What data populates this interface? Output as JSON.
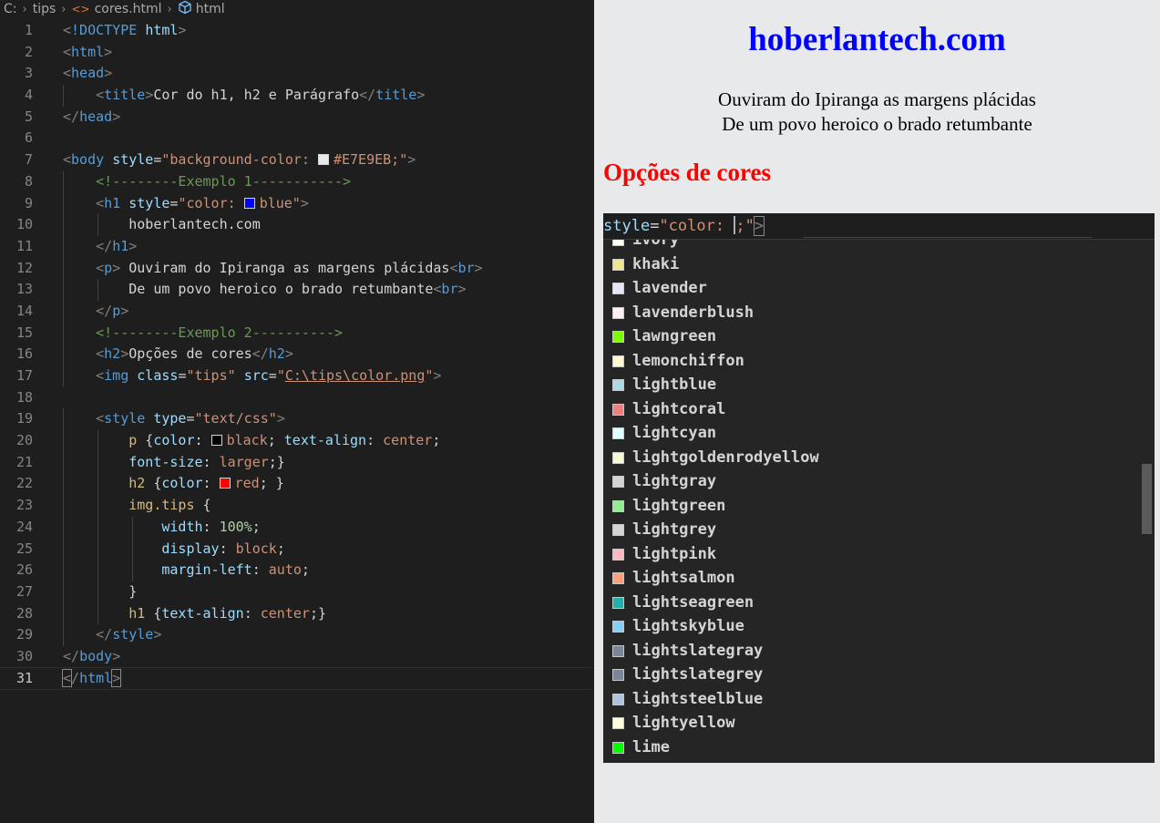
{
  "breadcrumb": {
    "drive": "C:",
    "folder": "tips",
    "file": "cores.html",
    "element": "html"
  },
  "editor": {
    "lines": [
      {
        "n": "1",
        "tokens": [
          {
            "t": "<",
            "c": "t-br"
          },
          {
            "t": "!DOCTYPE",
            "c": "t-tag"
          },
          {
            "t": " ",
            "c": "t-txt"
          },
          {
            "t": "html",
            "c": "t-attr"
          },
          {
            "t": ">",
            "c": "t-br"
          }
        ]
      },
      {
        "n": "2",
        "tokens": [
          {
            "t": "<",
            "c": "t-br"
          },
          {
            "t": "html",
            "c": "t-tag"
          },
          {
            "t": ">",
            "c": "t-br"
          }
        ]
      },
      {
        "n": "3",
        "tokens": [
          {
            "t": "<",
            "c": "t-br"
          },
          {
            "t": "head",
            "c": "t-tag"
          },
          {
            "t": ">",
            "c": "t-br"
          }
        ]
      },
      {
        "n": "4",
        "tokens": [
          {
            "t": "    "
          },
          {
            "t": "<",
            "c": "t-br"
          },
          {
            "t": "title",
            "c": "t-tag"
          },
          {
            "t": ">",
            "c": "t-br"
          },
          {
            "t": "Cor do h1, h2 e Parágrafo",
            "c": "t-txt"
          },
          {
            "t": "</",
            "c": "t-br"
          },
          {
            "t": "title",
            "c": "t-tag"
          },
          {
            "t": ">",
            "c": "t-br"
          }
        ]
      },
      {
        "n": "5",
        "tokens": [
          {
            "t": "</",
            "c": "t-br"
          },
          {
            "t": "head",
            "c": "t-tag"
          },
          {
            "t": ">",
            "c": "t-br"
          }
        ]
      },
      {
        "n": "6",
        "tokens": []
      },
      {
        "n": "7",
        "tokens": [
          {
            "t": "<",
            "c": "t-br"
          },
          {
            "t": "body",
            "c": "t-tag"
          },
          {
            "t": " ",
            "c": "t-txt"
          },
          {
            "t": "style",
            "c": "t-attr"
          },
          {
            "t": "=",
            "c": "t-txt"
          },
          {
            "t": "\"background-color: ",
            "c": "t-str"
          },
          {
            "sw": "#e7e9eb"
          },
          {
            "t": "#E7E9EB;\"",
            "c": "t-str"
          },
          {
            "t": ">",
            "c": "t-br"
          }
        ]
      },
      {
        "n": "8",
        "tokens": [
          {
            "t": "    "
          },
          {
            "t": "<!--------Exemplo 1----------->",
            "c": "t-cmt"
          }
        ]
      },
      {
        "n": "9",
        "tokens": [
          {
            "t": "    "
          },
          {
            "t": "<",
            "c": "t-br"
          },
          {
            "t": "h1",
            "c": "t-tag"
          },
          {
            "t": " ",
            "c": "t-txt"
          },
          {
            "t": "style",
            "c": "t-attr"
          },
          {
            "t": "=",
            "c": "t-txt"
          },
          {
            "t": "\"color: ",
            "c": "t-str"
          },
          {
            "sw": "#0000ff"
          },
          {
            "t": "blue\"",
            "c": "t-str"
          },
          {
            "t": ">",
            "c": "t-br"
          }
        ]
      },
      {
        "n": "10",
        "tokens": [
          {
            "t": "        "
          },
          {
            "t": "hoberlantech.com",
            "c": "t-txt"
          }
        ]
      },
      {
        "n": "11",
        "tokens": [
          {
            "t": "    "
          },
          {
            "t": "</",
            "c": "t-br"
          },
          {
            "t": "h1",
            "c": "t-tag"
          },
          {
            "t": ">",
            "c": "t-br"
          }
        ]
      },
      {
        "n": "12",
        "tokens": [
          {
            "t": "    "
          },
          {
            "t": "<",
            "c": "t-br"
          },
          {
            "t": "p",
            "c": "t-tag"
          },
          {
            "t": ">",
            "c": "t-br"
          },
          {
            "t": " Ouviram do Ipiranga as margens plácidas",
            "c": "t-txt"
          },
          {
            "t": "<",
            "c": "t-br"
          },
          {
            "t": "br",
            "c": "t-tag"
          },
          {
            "t": ">",
            "c": "t-br"
          }
        ]
      },
      {
        "n": "13",
        "tokens": [
          {
            "t": "        "
          },
          {
            "t": "De um povo heroico o brado retumbante",
            "c": "t-txt"
          },
          {
            "t": "<",
            "c": "t-br"
          },
          {
            "t": "br",
            "c": "t-tag"
          },
          {
            "t": ">",
            "c": "t-br"
          }
        ]
      },
      {
        "n": "14",
        "tokens": [
          {
            "t": "    "
          },
          {
            "t": "</",
            "c": "t-br"
          },
          {
            "t": "p",
            "c": "t-tag"
          },
          {
            "t": ">",
            "c": "t-br"
          }
        ]
      },
      {
        "n": "15",
        "tokens": [
          {
            "t": "    "
          },
          {
            "t": "<!--------Exemplo 2---------->",
            "c": "t-cmt"
          }
        ]
      },
      {
        "n": "16",
        "tokens": [
          {
            "t": "    "
          },
          {
            "t": "<",
            "c": "t-br"
          },
          {
            "t": "h2",
            "c": "t-tag"
          },
          {
            "t": ">",
            "c": "t-br"
          },
          {
            "t": "Opções de cores",
            "c": "t-txt"
          },
          {
            "t": "</",
            "c": "t-br"
          },
          {
            "t": "h2",
            "c": "t-tag"
          },
          {
            "t": ">",
            "c": "t-br"
          }
        ]
      },
      {
        "n": "17",
        "tokens": [
          {
            "t": "    "
          },
          {
            "t": "<",
            "c": "t-br"
          },
          {
            "t": "img",
            "c": "t-tag"
          },
          {
            "t": " ",
            "c": "t-txt"
          },
          {
            "t": "class",
            "c": "t-attr"
          },
          {
            "t": "=",
            "c": "t-txt"
          },
          {
            "t": "\"tips\"",
            "c": "t-str"
          },
          {
            "t": " ",
            "c": "t-txt"
          },
          {
            "t": "src",
            "c": "t-attr"
          },
          {
            "t": "=",
            "c": "t-txt"
          },
          {
            "t": "\"",
            "c": "t-str"
          },
          {
            "t": "C:\\tips\\color.png",
            "c": "t-link"
          },
          {
            "t": "\"",
            "c": "t-str"
          },
          {
            "t": ">",
            "c": "t-br"
          }
        ]
      },
      {
        "n": "18",
        "tokens": []
      },
      {
        "n": "19",
        "tokens": [
          {
            "t": "    "
          },
          {
            "t": "<",
            "c": "t-br"
          },
          {
            "t": "style",
            "c": "t-tag"
          },
          {
            "t": " ",
            "c": "t-txt"
          },
          {
            "t": "type",
            "c": "t-attr"
          },
          {
            "t": "=",
            "c": "t-txt"
          },
          {
            "t": "\"text/css\"",
            "c": "t-str"
          },
          {
            "t": ">",
            "c": "t-br"
          }
        ]
      },
      {
        "n": "20",
        "tokens": [
          {
            "t": "        "
          },
          {
            "t": "p",
            "c": "t-sel"
          },
          {
            "t": " {",
            "c": "t-txt"
          },
          {
            "t": "color",
            "c": "t-prop"
          },
          {
            "t": ": ",
            "c": "t-txt"
          },
          {
            "sw": "#000000"
          },
          {
            "t": "black",
            "c": "t-str"
          },
          {
            "t": "; ",
            "c": "t-txt"
          },
          {
            "t": "text-align",
            "c": "t-prop"
          },
          {
            "t": ": ",
            "c": "t-txt"
          },
          {
            "t": "center",
            "c": "t-str"
          },
          {
            "t": ";",
            "c": "t-txt"
          }
        ]
      },
      {
        "n": "21",
        "tokens": [
          {
            "t": "        "
          },
          {
            "t": "font-size",
            "c": "t-prop"
          },
          {
            "t": ": ",
            "c": "t-txt"
          },
          {
            "t": "larger",
            "c": "t-str"
          },
          {
            "t": ";}",
            "c": "t-txt"
          }
        ]
      },
      {
        "n": "22",
        "tokens": [
          {
            "t": "        "
          },
          {
            "t": "h2",
            "c": "t-sel"
          },
          {
            "t": " {",
            "c": "t-txt"
          },
          {
            "t": "color",
            "c": "t-prop"
          },
          {
            "t": ": ",
            "c": "t-txt"
          },
          {
            "sw": "#ff0000"
          },
          {
            "t": "red",
            "c": "t-str"
          },
          {
            "t": "; }",
            "c": "t-txt"
          }
        ]
      },
      {
        "n": "23",
        "tokens": [
          {
            "t": "        "
          },
          {
            "t": "img.tips",
            "c": "t-sel"
          },
          {
            "t": " {",
            "c": "t-txt"
          }
        ]
      },
      {
        "n": "24",
        "tokens": [
          {
            "t": "            "
          },
          {
            "t": "width",
            "c": "t-prop"
          },
          {
            "t": ": ",
            "c": "t-txt"
          },
          {
            "t": "100%",
            "c": "t-num"
          },
          {
            "t": ";",
            "c": "t-txt"
          }
        ]
      },
      {
        "n": "25",
        "tokens": [
          {
            "t": "            "
          },
          {
            "t": "display",
            "c": "t-prop"
          },
          {
            "t": ": ",
            "c": "t-txt"
          },
          {
            "t": "block",
            "c": "t-str"
          },
          {
            "t": ";",
            "c": "t-txt"
          }
        ]
      },
      {
        "n": "26",
        "tokens": [
          {
            "t": "            "
          },
          {
            "t": "margin-left",
            "c": "t-prop"
          },
          {
            "t": ": ",
            "c": "t-txt"
          },
          {
            "t": "auto",
            "c": "t-str"
          },
          {
            "t": ";",
            "c": "t-txt"
          }
        ]
      },
      {
        "n": "27",
        "tokens": [
          {
            "t": "        "
          },
          {
            "t": "}",
            "c": "t-txt"
          }
        ]
      },
      {
        "n": "28",
        "tokens": [
          {
            "t": "        "
          },
          {
            "t": "h1",
            "c": "t-sel"
          },
          {
            "t": " {",
            "c": "t-txt"
          },
          {
            "t": "text-align",
            "c": "t-prop"
          },
          {
            "t": ": ",
            "c": "t-txt"
          },
          {
            "t": "center",
            "c": "t-str"
          },
          {
            "t": ";}",
            "c": "t-txt"
          }
        ]
      },
      {
        "n": "29",
        "tokens": [
          {
            "t": "    "
          },
          {
            "t": "</",
            "c": "t-br"
          },
          {
            "t": "style",
            "c": "t-tag"
          },
          {
            "t": ">",
            "c": "t-br"
          }
        ]
      },
      {
        "n": "30",
        "tokens": [
          {
            "t": "</",
            "c": "t-br"
          },
          {
            "t": "body",
            "c": "t-tag"
          },
          {
            "t": ">",
            "c": "t-br"
          }
        ]
      },
      {
        "n": "31",
        "tokens": [
          {
            "t": "<",
            "c": "t-br caret-bracket"
          },
          {
            "t": "/",
            "c": "t-br"
          },
          {
            "t": "html",
            "c": "t-tag"
          },
          {
            "t": ">",
            "c": "t-br caret-bracket"
          }
        ]
      }
    ]
  },
  "preview": {
    "h1": "hoberlantech.com",
    "p_line1": "Ouviram do Ipiranga as margens plácidas",
    "p_line2": "De um povo heroico o brado retumbante",
    "h2": "Opções de cores"
  },
  "tips_image": {
    "code_attr": "style",
    "code_eq": "=",
    "code_str": "\"color: ",
    "code_end": ";\"",
    "code_close": ">",
    "suggestions": [
      {
        "name": "ivory",
        "color": "#fffff0"
      },
      {
        "name": "khaki",
        "color": "#f0e68c"
      },
      {
        "name": "lavender",
        "color": "#e6e6fa"
      },
      {
        "name": "lavenderblush",
        "color": "#fff0f5"
      },
      {
        "name": "lawngreen",
        "color": "#7cfc00"
      },
      {
        "name": "lemonchiffon",
        "color": "#fffacd"
      },
      {
        "name": "lightblue",
        "color": "#add8e6"
      },
      {
        "name": "lightcoral",
        "color": "#f08080"
      },
      {
        "name": "lightcyan",
        "color": "#e0ffff"
      },
      {
        "name": "lightgoldenrodyellow",
        "color": "#fafad2"
      },
      {
        "name": "lightgray",
        "color": "#d3d3d3"
      },
      {
        "name": "lightgreen",
        "color": "#90ee90"
      },
      {
        "name": "lightgrey",
        "color": "#d3d3d3"
      },
      {
        "name": "lightpink",
        "color": "#ffb6c1"
      },
      {
        "name": "lightsalmon",
        "color": "#ffa07a"
      },
      {
        "name": "lightseagreen",
        "color": "#20b2aa"
      },
      {
        "name": "lightskyblue",
        "color": "#87cefa"
      },
      {
        "name": "lightslategray",
        "color": "#778899"
      },
      {
        "name": "lightslategrey",
        "color": "#778899"
      },
      {
        "name": "lightsteelblue",
        "color": "#b0c4de"
      },
      {
        "name": "lightyellow",
        "color": "#ffffe0"
      },
      {
        "name": "lime",
        "color": "#00ff00"
      }
    ]
  }
}
